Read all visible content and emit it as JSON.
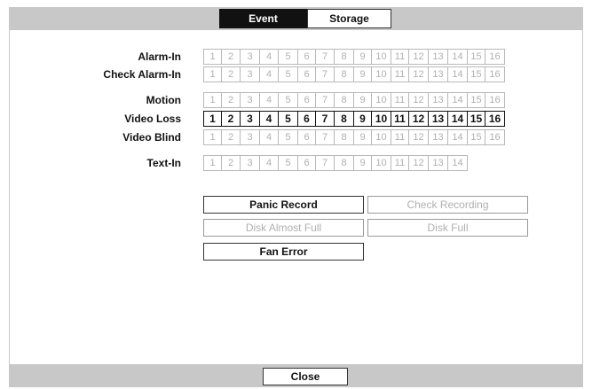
{
  "tabs": [
    {
      "label": "Event",
      "selected": true
    },
    {
      "label": "Storage",
      "selected": false
    }
  ],
  "grid_rows": [
    {
      "label": "Alarm-In",
      "cells": [
        "1",
        "2",
        "3",
        "4",
        "5",
        "6",
        "7",
        "8",
        "9",
        "10",
        "11",
        "12",
        "13",
        "14",
        "15",
        "16"
      ],
      "enabled": false
    },
    {
      "label": "Check Alarm-In",
      "cells": [
        "1",
        "2",
        "3",
        "4",
        "5",
        "6",
        "7",
        "8",
        "9",
        "10",
        "11",
        "12",
        "13",
        "14",
        "15",
        "16"
      ],
      "enabled": false
    },
    {
      "label": "Motion",
      "cells": [
        "1",
        "2",
        "3",
        "4",
        "5",
        "6",
        "7",
        "8",
        "9",
        "10",
        "11",
        "12",
        "13",
        "14",
        "15",
        "16"
      ],
      "enabled": false
    },
    {
      "label": "Video Loss",
      "cells": [
        "1",
        "2",
        "3",
        "4",
        "5",
        "6",
        "7",
        "8",
        "9",
        "10",
        "11",
        "12",
        "13",
        "14",
        "15",
        "16"
      ],
      "enabled": true
    },
    {
      "label": "Video Blind",
      "cells": [
        "1",
        "2",
        "3",
        "4",
        "5",
        "6",
        "7",
        "8",
        "9",
        "10",
        "11",
        "12",
        "13",
        "14",
        "15",
        "16"
      ],
      "enabled": false
    },
    {
      "label": "Text-In",
      "cells": [
        "1",
        "2",
        "3",
        "4",
        "5",
        "6",
        "7",
        "8",
        "9",
        "10",
        "11",
        "12",
        "13",
        "14"
      ],
      "enabled": false
    }
  ],
  "event_buttons": [
    {
      "label": "Panic Record",
      "enabled": true
    },
    {
      "label": "Check Recording",
      "enabled": false
    },
    {
      "label": "Disk Almost Full",
      "enabled": false
    },
    {
      "label": "Disk Full",
      "enabled": false
    },
    {
      "label": "Fan Error",
      "enabled": true
    }
  ],
  "close_label": "Close"
}
